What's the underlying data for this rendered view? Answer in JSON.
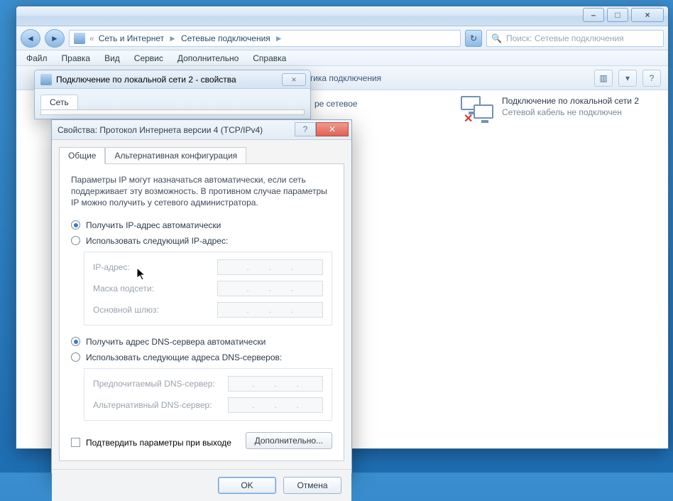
{
  "explorer": {
    "breadcrumb": [
      "Сеть и Интернет",
      "Сетевые подключения"
    ],
    "search_placeholder": "Поиск: Сетевые подключения",
    "menu": [
      "Файл",
      "Правка",
      "Вид",
      "Сервис",
      "Дополнительно",
      "Справка"
    ],
    "toolbar_hint": "ітика подключения",
    "right_col": "ре сетевое",
    "connection": {
      "name": "Подключение по локальной сети 2",
      "status": "Сетевой кабель не подключен"
    }
  },
  "dlg1": {
    "title": "Подключение по локальной сети 2 - свойства",
    "tab": "Сеть"
  },
  "dlg2": {
    "title": "Свойства: Протокол Интернета версии 4 (TCP/IPv4)",
    "tab_general": "Общие",
    "tab_alt": "Альтернативная конфигурация",
    "desc": "Параметры IP могут назначаться автоматически, если сеть поддерживает эту возможность. В противном случае параметры IP можно получить у сетевого администратора.",
    "radio_ip_auto": "Получить IP-адрес автоматически",
    "radio_ip_manual": "Использовать следующий IP-адрес:",
    "field_ip": "IP-адрес:",
    "field_mask": "Маска подсети:",
    "field_gw": "Основной шлюз:",
    "radio_dns_auto": "Получить адрес DNS-сервера автоматически",
    "radio_dns_manual": "Использовать следующие адреса DNS-серверов:",
    "field_dns1": "Предпочитаемый DNS-сервер:",
    "field_dns2": "Альтернативный DNS-сервер:",
    "chk_validate": "Подтвердить параметры при выходе",
    "btn_advanced": "Дополнительно...",
    "btn_ok": "OK",
    "btn_cancel": "Отмена"
  }
}
